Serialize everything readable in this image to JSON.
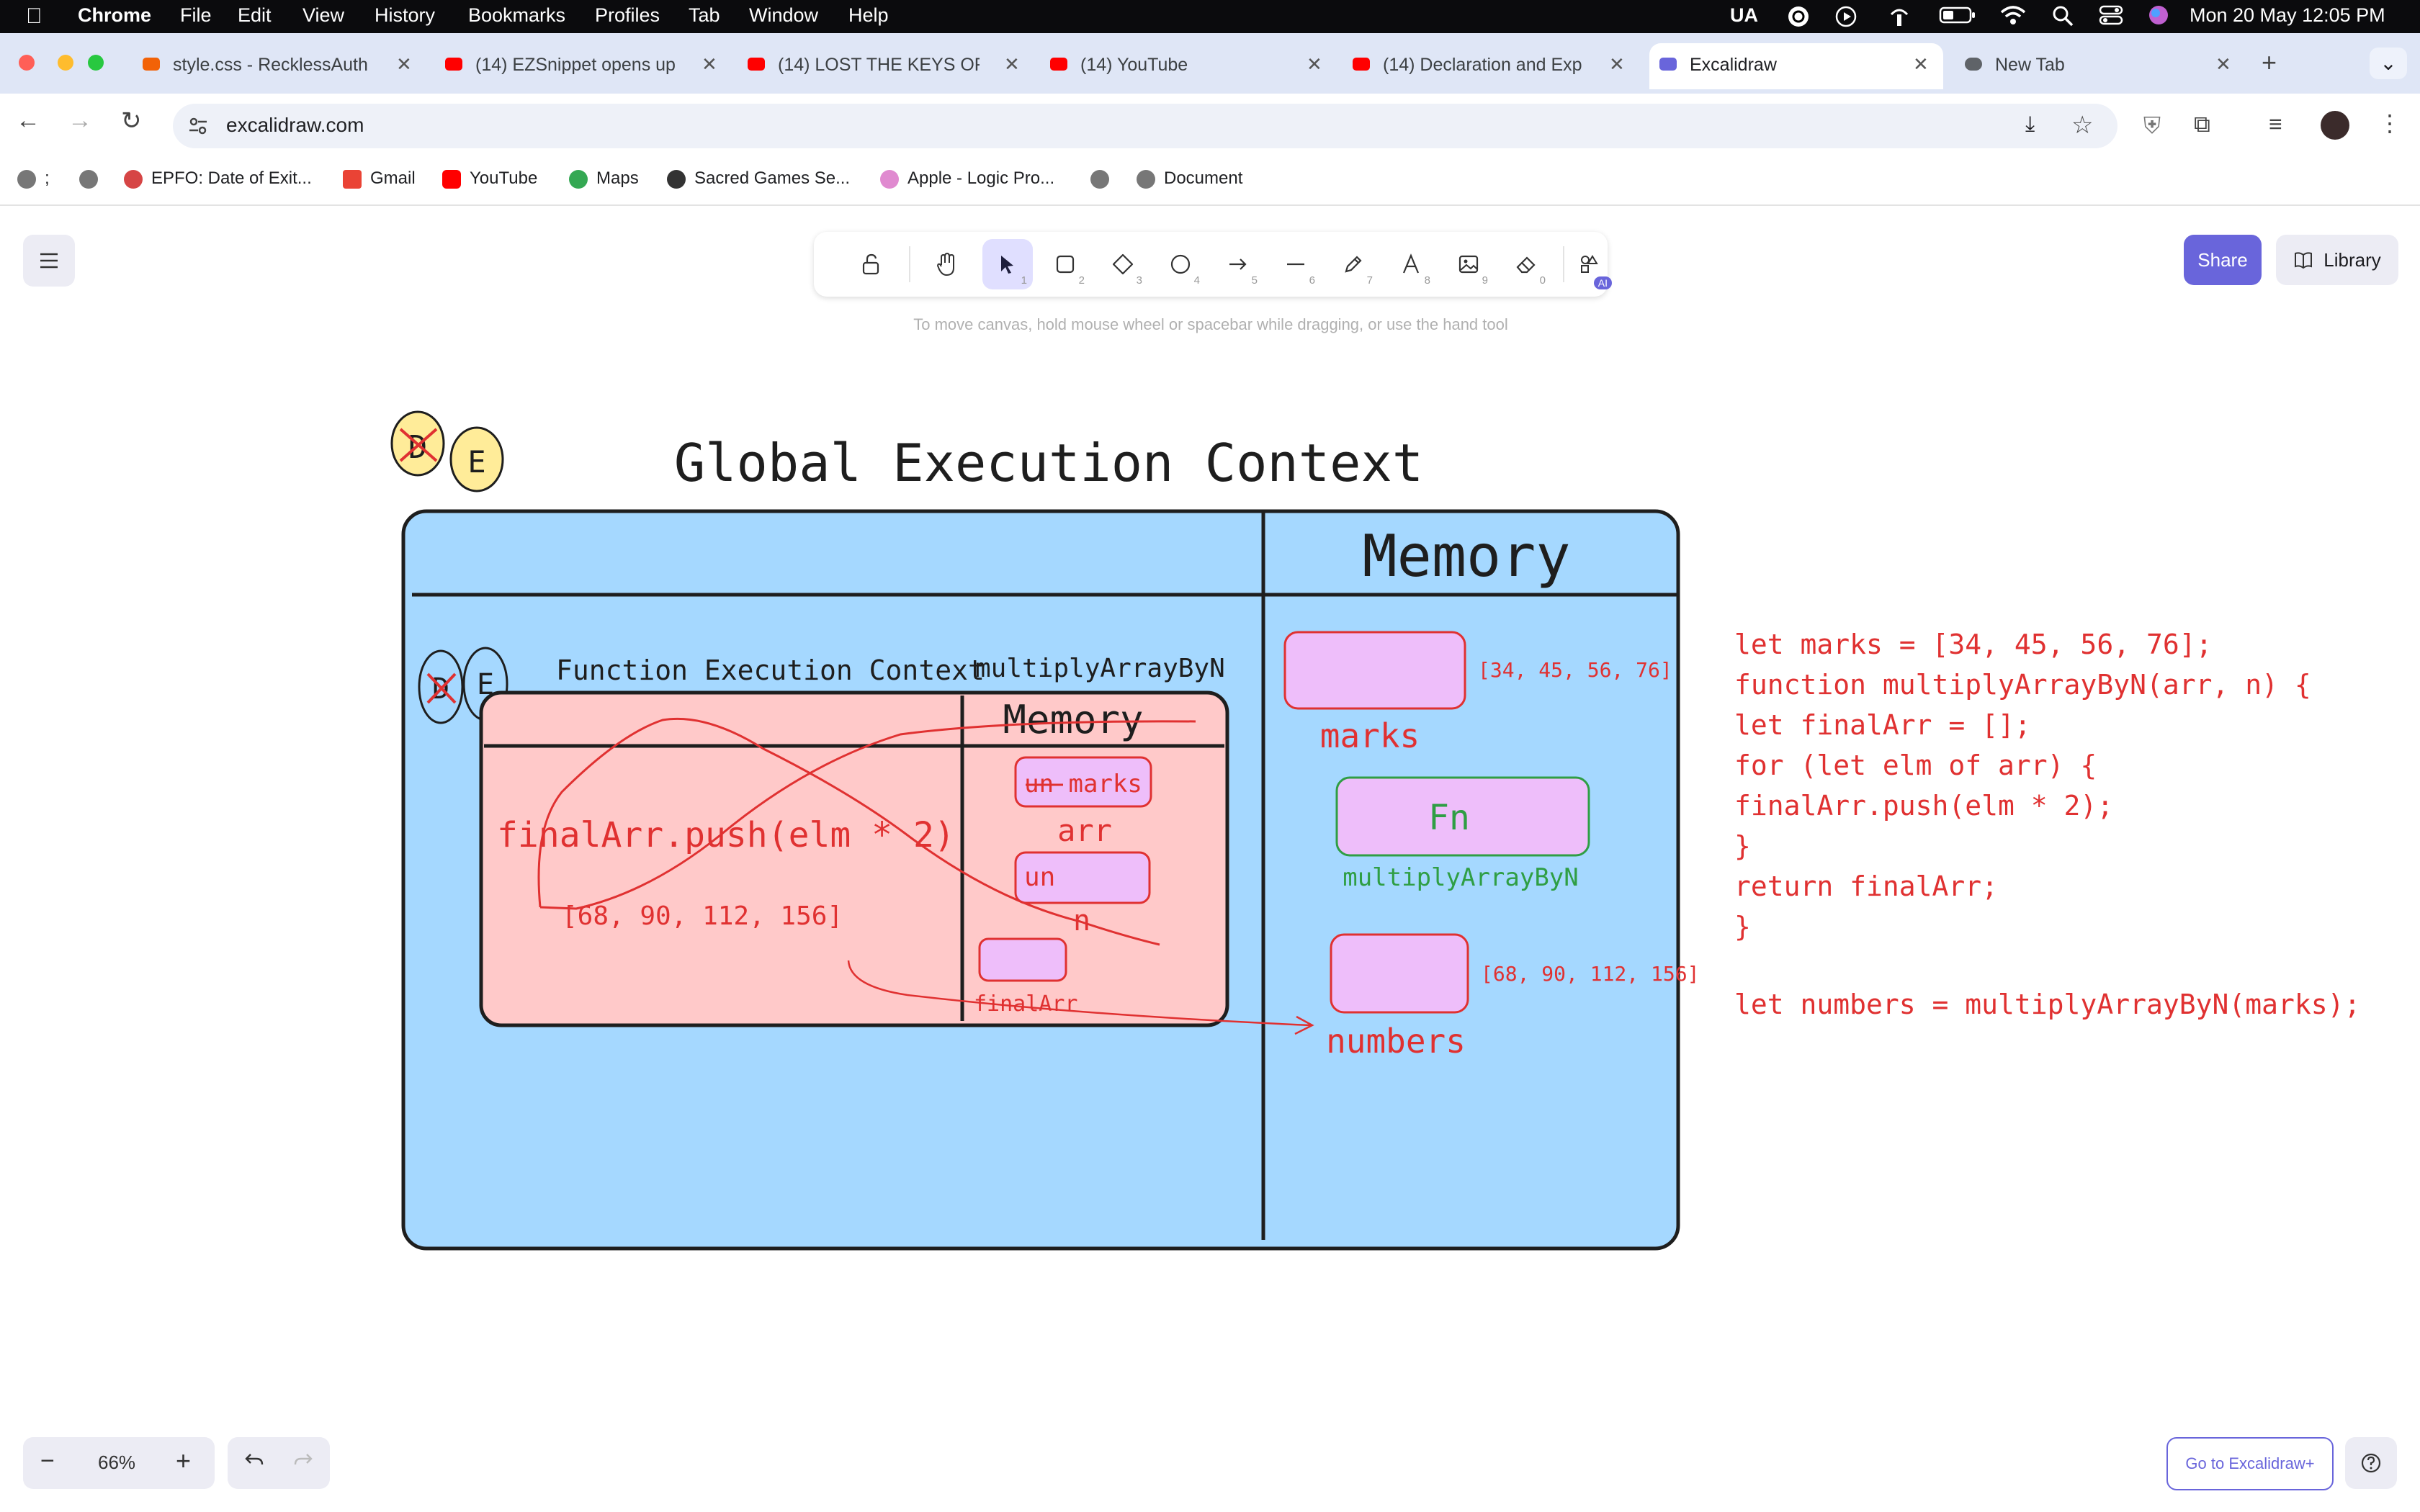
{
  "menubar": {
    "app": "Chrome",
    "items": [
      "File",
      "Edit",
      "View",
      "History",
      "Bookmarks",
      "Profiles",
      "Tab",
      "Window",
      "Help"
    ],
    "input_source": "UA",
    "datetime": "Mon 20 May  12:05 PM"
  },
  "tabs": [
    {
      "label": "style.css - RecklessAuth",
      "favicon": "replit"
    },
    {
      "label": "(14) EZSnippet opens up",
      "favicon": "youtube"
    },
    {
      "label": "(14) LOST THE KEYS OF",
      "favicon": "youtube"
    },
    {
      "label": "(14) YouTube",
      "favicon": "youtube"
    },
    {
      "label": "(14) Declaration and Exp",
      "favicon": "youtube"
    },
    {
      "label": "Excalidraw",
      "favicon": "excalidraw",
      "active": true
    },
    {
      "label": "New Tab",
      "favicon": "chrome"
    }
  ],
  "address": {
    "url": "excalidraw.com"
  },
  "bookmarks": [
    {
      "label": ";"
    },
    {
      "label": ""
    },
    {
      "label": "EPFO: Date of Exit..."
    },
    {
      "label": "Gmail"
    },
    {
      "label": "YouTube"
    },
    {
      "label": "Maps"
    },
    {
      "label": "Sacred Games Se..."
    },
    {
      "label": "Apple - Logic Pro..."
    },
    {
      "label": ""
    },
    {
      "label": "Document"
    }
  ],
  "excalidraw": {
    "share_label": "Share",
    "library_label": "Library",
    "hint": "To move canvas, hold mouse wheel or spacebar while dragging, or use the hand tool",
    "zoom": "66%",
    "go_plus_label": "Go to Excalidraw+",
    "ai_badge": "AI",
    "tool_keys": [
      "1",
      "2",
      "3",
      "4",
      "5",
      "6",
      "7",
      "8",
      "9",
      "0"
    ]
  },
  "canvas": {
    "title": "Global Execution Context",
    "memory_title": "Memory",
    "badge_d": "D",
    "badge_e": "E",
    "inner_badge_d": "D",
    "inner_badge_e": "E",
    "fec_title": "Function Execution Context",
    "fec_name": "multiplyArrayByN",
    "fec_memory": "Memory",
    "fec_code": "finalArr.push(elm * 2)",
    "fec_result": "[68, 90, 112, 156]",
    "fec_un_marks": "un marks",
    "fec_arr": "arr",
    "fec_un": "un",
    "fec_n": "n",
    "fec_finalArr": "finalArr",
    "marks_value": "[34, 45, 56, 76]",
    "marks_label": "marks",
    "fn_label": "Fn",
    "fn_name": "multiplyArrayByN",
    "numbers_value": "[68, 90, 112, 156]",
    "numbers_label": "numbers",
    "code_lines": [
      "let marks = [34, 45, 56, 76];",
      "function multiplyArrayByN(arr, n) {",
      "let finalArr = [];",
      "for (let elm of arr) {",
      "finalArr.push(elm * 2);",
      "}",
      "return finalArr;",
      "}",
      "",
      "let numbers = multiplyArrayByN(marks);"
    ]
  },
  "colors": {
    "panel_blue": "#a5d8ff",
    "pink_box": "#ffc9c9",
    "lilac": "#eebefa",
    "red": "#e03131",
    "green": "#2f9e44",
    "accent": "#6965db"
  }
}
